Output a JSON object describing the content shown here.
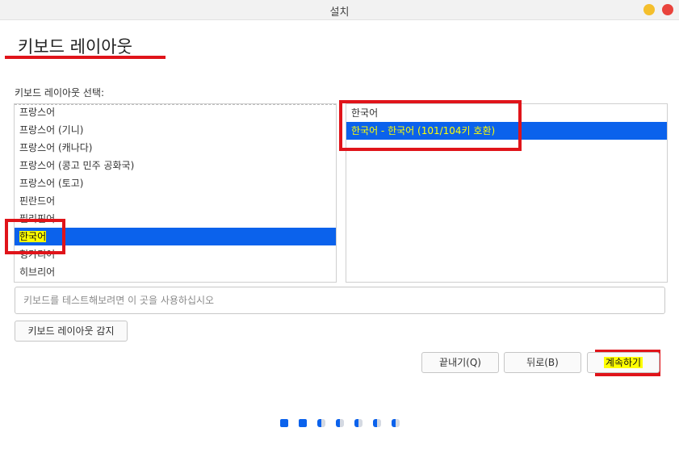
{
  "window": {
    "title": "설치"
  },
  "page_title": "키보드 레이아웃",
  "layout_list": {
    "label": "키보드 레이아웃 선택:",
    "items": [
      "프랑스어",
      "프랑스어 (기니)",
      "프랑스어 (캐나다)",
      "프랑스어 (콩고 민주 공화국)",
      "프랑스어 (토고)",
      "핀란드어",
      "필리핀어",
      "한국어",
      "헝가리어",
      "히브리어"
    ],
    "selected": "한국어"
  },
  "variant_list": {
    "items": [
      "한국어",
      "한국어 - 한국어 (101/104키 호환)"
    ],
    "selected": "한국어 - 한국어 (101/104키 호환)"
  },
  "test_input": {
    "placeholder": "키보드를 테스트해보려면 이 곳을 사용하십시오",
    "value": ""
  },
  "buttons": {
    "detect": "키보드 레이아웃 감지",
    "quit": "끝내기(Q)",
    "back": "뒤로(B)",
    "continue": "계속하기"
  },
  "progress": {
    "total_steps": 7,
    "completed_steps": 2
  },
  "colors": {
    "selection": "#0b62ec",
    "annotation": "#e0141a",
    "highlight": "#ffff00"
  }
}
